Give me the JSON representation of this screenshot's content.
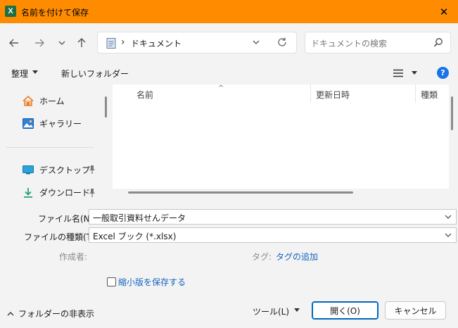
{
  "titlebar": {
    "app_badge": "X",
    "title": "名前を付けて保存",
    "close_glyph": "✕"
  },
  "nav": {
    "back_icon": "arrow-left-icon",
    "forward_icon": "arrow-right-icon",
    "recent_icon": "chevron-down-icon",
    "up_icon": "arrow-up-icon",
    "address_separator": "›",
    "address_path": "ドキュメント",
    "search_placeholder": "ドキュメントの検索"
  },
  "toolbar": {
    "organize": "整理",
    "new_folder": "新しいフォルダー",
    "help_glyph": "?"
  },
  "sidebar": {
    "items": [
      {
        "label": "ホーム",
        "icon": "home-icon"
      },
      {
        "label": "ギャラリー",
        "icon": "gallery-icon"
      },
      {
        "label": "デスクトップ",
        "icon": "desktop-icon",
        "pinned": true
      },
      {
        "label": "ダウンロード",
        "icon": "download-icon",
        "pinned": true
      }
    ]
  },
  "file_list": {
    "columns": [
      "名前",
      "更新日時",
      "種類"
    ],
    "sort_glyph": "^",
    "rows": []
  },
  "form": {
    "filename_label": "ファイル名(N):",
    "filename_value": "一般取引資料せんデータ",
    "filetype_label": "ファイルの種類(T):",
    "filetype_value": "Excel ブック (*.xlsx)",
    "author_label": "作成者:",
    "tags_label": "タグ:",
    "tags_link": "タグの追加",
    "thumbnail_label": "縮小版を保存する",
    "thumbnail_checked": false
  },
  "footer": {
    "hide_folders": "フォルダーの非表示",
    "tools": "ツール(L)",
    "open_button": "開く(O)",
    "cancel_button": "キャンセル"
  },
  "colors": {
    "titlebar": "#ff8c00",
    "accent": "#0067c0",
    "link": "#1565c0",
    "excel_green": "#1d6f42"
  }
}
